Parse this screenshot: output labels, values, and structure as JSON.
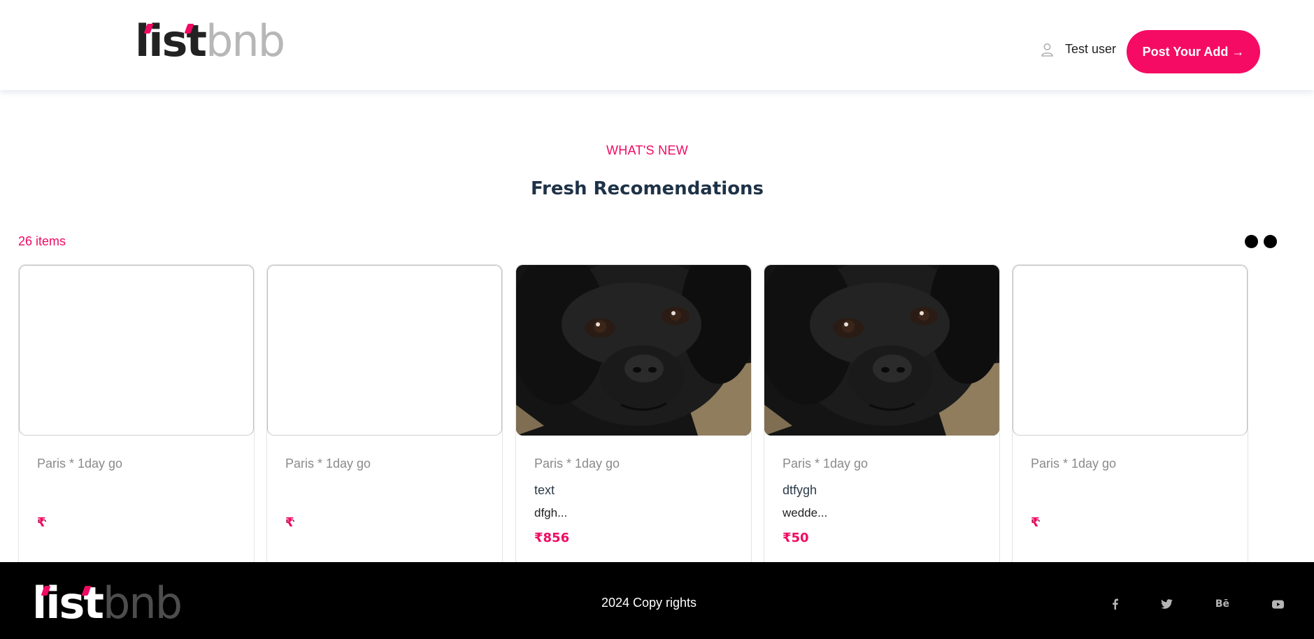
{
  "header": {
    "logo": {
      "part1": "list",
      "part2": "bnb"
    },
    "user_name": "Test user",
    "post_button": "Post Your Add →"
  },
  "section": {
    "eyebrow": "WHAT'S NEW",
    "title": "Fresh Recomendations",
    "count": "26 items"
  },
  "cards": [
    {
      "image": "empty",
      "meta": "Paris * 1day go",
      "title": "",
      "description": "...",
      "price": "₹"
    },
    {
      "image": "empty",
      "meta": "Paris * 1day go",
      "title": "",
      "description": "...",
      "price": "₹"
    },
    {
      "image": "black-labrador-puppy-photo",
      "meta": "Paris * 1day go",
      "title": "text",
      "description": "dfgh...",
      "price": "₹856"
    },
    {
      "image": "black-labrador-puppy-photo",
      "meta": "Paris * 1day go",
      "title": "dtfygh",
      "description": "wedde...",
      "price": "₹50"
    },
    {
      "image": "empty",
      "meta": "Paris * 1day go",
      "title": "",
      "description": "...",
      "price": "₹"
    }
  ],
  "footer": {
    "logo": {
      "part1": "list",
      "part2": "bnb"
    },
    "copyright": "2024 Copy rights",
    "social_icons": [
      "facebook-icon",
      "twitter-icon",
      "behance-icon",
      "youtube-icon"
    ],
    "behance_label": "Bē"
  },
  "colors": {
    "accent": "#f50b63",
    "heading": "#1e3247",
    "footer_bg": "#000000"
  }
}
